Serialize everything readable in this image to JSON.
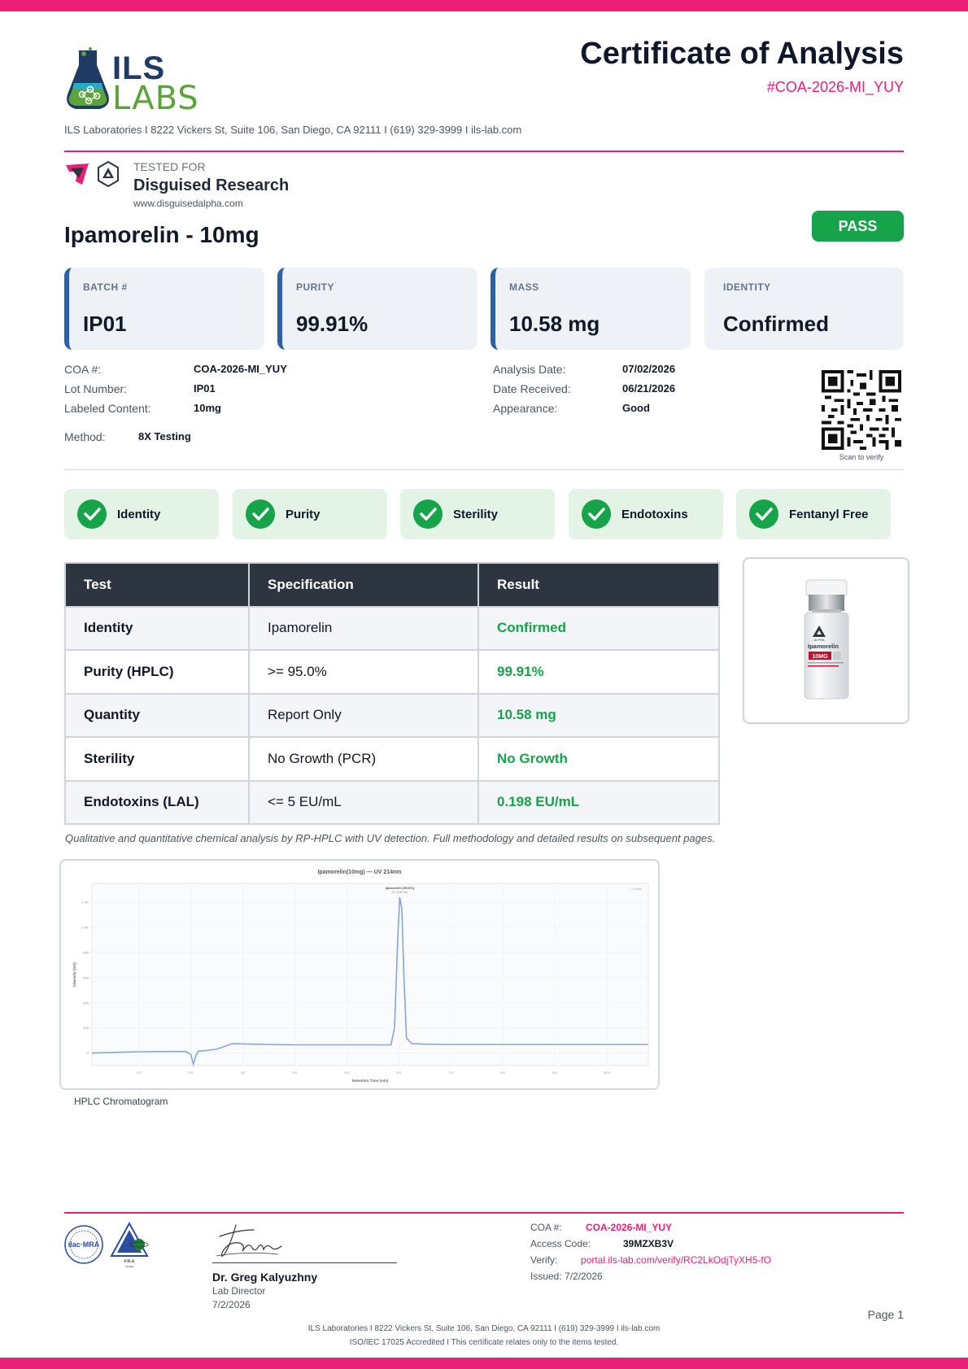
{
  "header": {
    "logo_line1": "ILS",
    "logo_line2": "LABS",
    "title": "Certificate of Analysis",
    "doc_id": "#COA-2026-MI_YUY",
    "lab_info": "ILS Laboratories  I  8222 Vickers St, Suite 106, San Diego, CA 92111  I  (619) 329-3999  I  ils-lab.com"
  },
  "client": {
    "tested_for_label": "TESTED FOR",
    "name": "Disguised Research",
    "url": "www.disguisedalpha.com"
  },
  "product": {
    "title": "Ipamorelin - 10mg",
    "status": "PASS"
  },
  "stats": [
    {
      "label": "BATCH #",
      "value": "IP01"
    },
    {
      "label": "PURITY",
      "value": "99.91%"
    },
    {
      "label": "MASS",
      "value": "10.58 mg"
    },
    {
      "label": "IDENTITY",
      "value": "Confirmed"
    }
  ],
  "details": {
    "coa_label": "COA #:",
    "coa_value": "COA-2026-MI_YUY",
    "lot_label": "Lot Number:",
    "lot_value": "IP01",
    "content_label": "Labeled Content:",
    "content_value": "10mg",
    "method_label": "Method:",
    "method_value": "8X Testing",
    "analysis_label": "Analysis Date:",
    "analysis_value": "07/02/2026",
    "received_label": "Date Received:",
    "received_value": "06/21/2026",
    "appearance_label": "Appearance:",
    "appearance_value": "Good",
    "qr_caption": "Scan to verify"
  },
  "checks": [
    {
      "label": "Identity"
    },
    {
      "label": "Purity"
    },
    {
      "label": "Sterility"
    },
    {
      "label": "Endotoxins"
    },
    {
      "label": "Fentanyl Free"
    }
  ],
  "table": {
    "headers": [
      "Test",
      "Specification",
      "Result"
    ],
    "rows": [
      [
        "Identity",
        "Ipamorelin",
        "Confirmed"
      ],
      [
        "Purity (HPLC)",
        ">= 95.0%",
        "99.91%"
      ],
      [
        "Quantity",
        "Report Only",
        "10.58 mg"
      ],
      [
        "Sterility",
        "No Growth (PCR)",
        "No Growth"
      ],
      [
        "Endotoxins (LAL)",
        "<= 5 EU/mL",
        "0.198 EU/mL"
      ]
    ]
  },
  "vial": {
    "brand": "ALPHA",
    "name": "Ipamorelin",
    "dose": "10MG"
  },
  "method_note": "Qualitative and quantitative chemical analysis by RP-HPLC with UV detection. Full methodology and detailed results on subsequent pages.",
  "chart_data": {
    "type": "line",
    "title": "Ipamorelin(10mg) — UV 214nm",
    "xlabel": "Retention Time (min)",
    "ylabel": "Intensity (mV)",
    "xlim": [
      0.1,
      10.8
    ],
    "ylim": [
      -100,
      1350
    ],
    "x_ticks": [
      "1.0",
      "2.0",
      "3.0",
      "4.0",
      "5.0",
      "6.0",
      "7.0",
      "8.0",
      "9.0",
      "10.0"
    ],
    "y_ticks": [
      "0",
      "200",
      "400",
      "600",
      "800",
      "1.0K",
      "1.2K"
    ],
    "peak_label": "Ipamorelin (99.9%)",
    "peak_sublabel": "RT: 6.05 min",
    "legend": "— 1 trace",
    "series": [
      {
        "x": [
          0.1,
          0.5,
          1.0,
          1.5,
          1.9,
          2.0,
          2.05,
          2.1,
          2.15,
          2.25,
          2.5,
          2.8,
          3.2,
          4.0,
          5.0,
          5.85,
          5.92,
          5.98,
          6.02,
          6.06,
          6.1,
          6.15,
          6.25,
          6.5,
          7.0,
          8.0,
          9.0,
          10.0,
          10.8
        ],
        "y": [
          0,
          5,
          10,
          12,
          12,
          -10,
          -90,
          -20,
          15,
          18,
          30,
          75,
          70,
          65,
          65,
          65,
          200,
          900,
          1240,
          1150,
          600,
          120,
          75,
          70,
          68,
          68,
          68,
          68,
          68
        ]
      }
    ]
  },
  "chrom_caption": "HPLC Chromatogram",
  "footer": {
    "accred_text": "PJLA",
    "accred_sub": "Testing",
    "signer_name": "Dr. Greg Kalyuzhny",
    "signer_title": "Lab Director",
    "signer_date": "7/2/2026",
    "coa_label": "COA #:",
    "coa_value": "COA-2026-MI_YUY",
    "access_label": "Access Code:",
    "access_value": "39MZXB3V",
    "verify_label": "Verify:",
    "verify_value": "portal.ils-lab.com/verify/RC2LkOdjTyXH5-fO",
    "issued": "Issued: 7/2/2026",
    "page": "Page 1",
    "address": "ILS Laboratories  I  8222 Vickers St, Suite 106, San Diego, CA 92111  I  (619) 329-3999  I  ils-lab.com",
    "disclaimer": "ISO/IEC 17025 Accredited  I  This certificate relates only to the items tested."
  },
  "colors": {
    "accent": "#ec1f78",
    "pass": "#16a34a",
    "navy": "#1f3b63",
    "header_dark": "#2d3640"
  }
}
